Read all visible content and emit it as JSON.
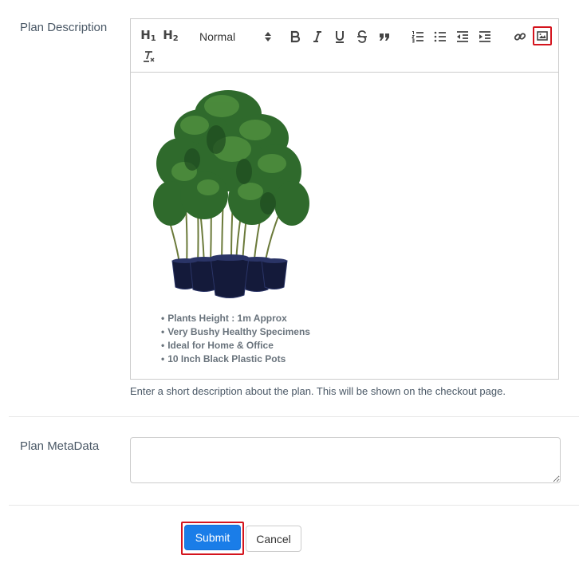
{
  "form": {
    "description_label": "Plan Description",
    "description_help": "Enter a short description about the plan. This will be shown on the checkout page.",
    "metadata_label": "Plan MetaData",
    "metadata_value": ""
  },
  "toolbar": {
    "h1_label": "H",
    "h1_sub": "1",
    "h2_label": "H",
    "h2_sub": "2",
    "format_select": "Normal",
    "icons": [
      "bold-icon",
      "italic-icon",
      "underline-icon",
      "strike-icon",
      "blockquote-icon",
      "ordered-list-icon",
      "bullet-list-icon",
      "outdent-icon",
      "indent-icon",
      "link-icon",
      "image-icon",
      "clear-format-icon"
    ],
    "highlight_color": "#d4141d"
  },
  "editor": {
    "bullets": [
      "Plants Height : 1m Approx",
      "Very Bushy Healthy Specimens",
      "Ideal for Home & Office",
      "10 Inch Black Plastic Pots"
    ]
  },
  "actions": {
    "submit_label": "Submit",
    "cancel_label": "Cancel",
    "submit_color": "#1a7de8"
  }
}
